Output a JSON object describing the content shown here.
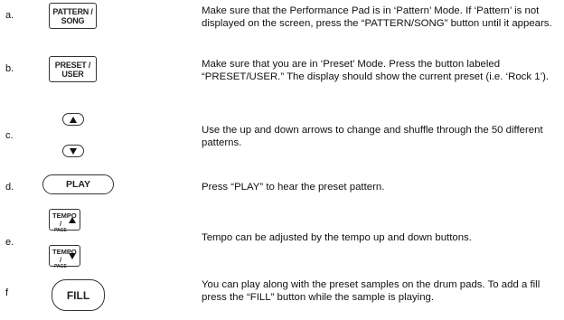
{
  "steps": [
    {
      "letter": "a.",
      "button": {
        "lines": [
          "PATTERN /",
          "SONG"
        ]
      },
      "text": "Make sure that the Performance Pad is in ‘Pattern’ Mode.  If ‘Pattern’ is not displayed on the screen, press the “PATTERN/SONG” button until it appears."
    },
    {
      "letter": "b.",
      "button": {
        "lines": [
          "PRESET /",
          "USER"
        ]
      },
      "text": "Make sure that you are in ‘Preset’ Mode.  Press the button labeled “PRESET/USER.”  The display should show the current preset (i.e. ‘Rock 1’)."
    },
    {
      "letter": "c.",
      "buttons": [
        "up-arrow-icon",
        "down-arrow-icon"
      ],
      "text": "Use the up and down arrows to change and shuffle through the 50 different patterns."
    },
    {
      "letter": "d.",
      "button": {
        "label": "PLAY"
      },
      "text": "Press “PLAY” to hear the preset pattern."
    },
    {
      "letter": "e.",
      "tempo_up": {
        "line1": "TEMPO /",
        "line2": "PAGE"
      },
      "tempo_down": {
        "line1": "TEMPO /",
        "line2": "PAGE"
      },
      "text": "Tempo can be adjusted by the tempo up and down buttons."
    },
    {
      "letter": "f",
      "button": {
        "label": "FILL"
      },
      "text": "You can play along with the preset samples on the drum pads.  To add a fill press the “FILL” button while the sample is playing."
    }
  ]
}
